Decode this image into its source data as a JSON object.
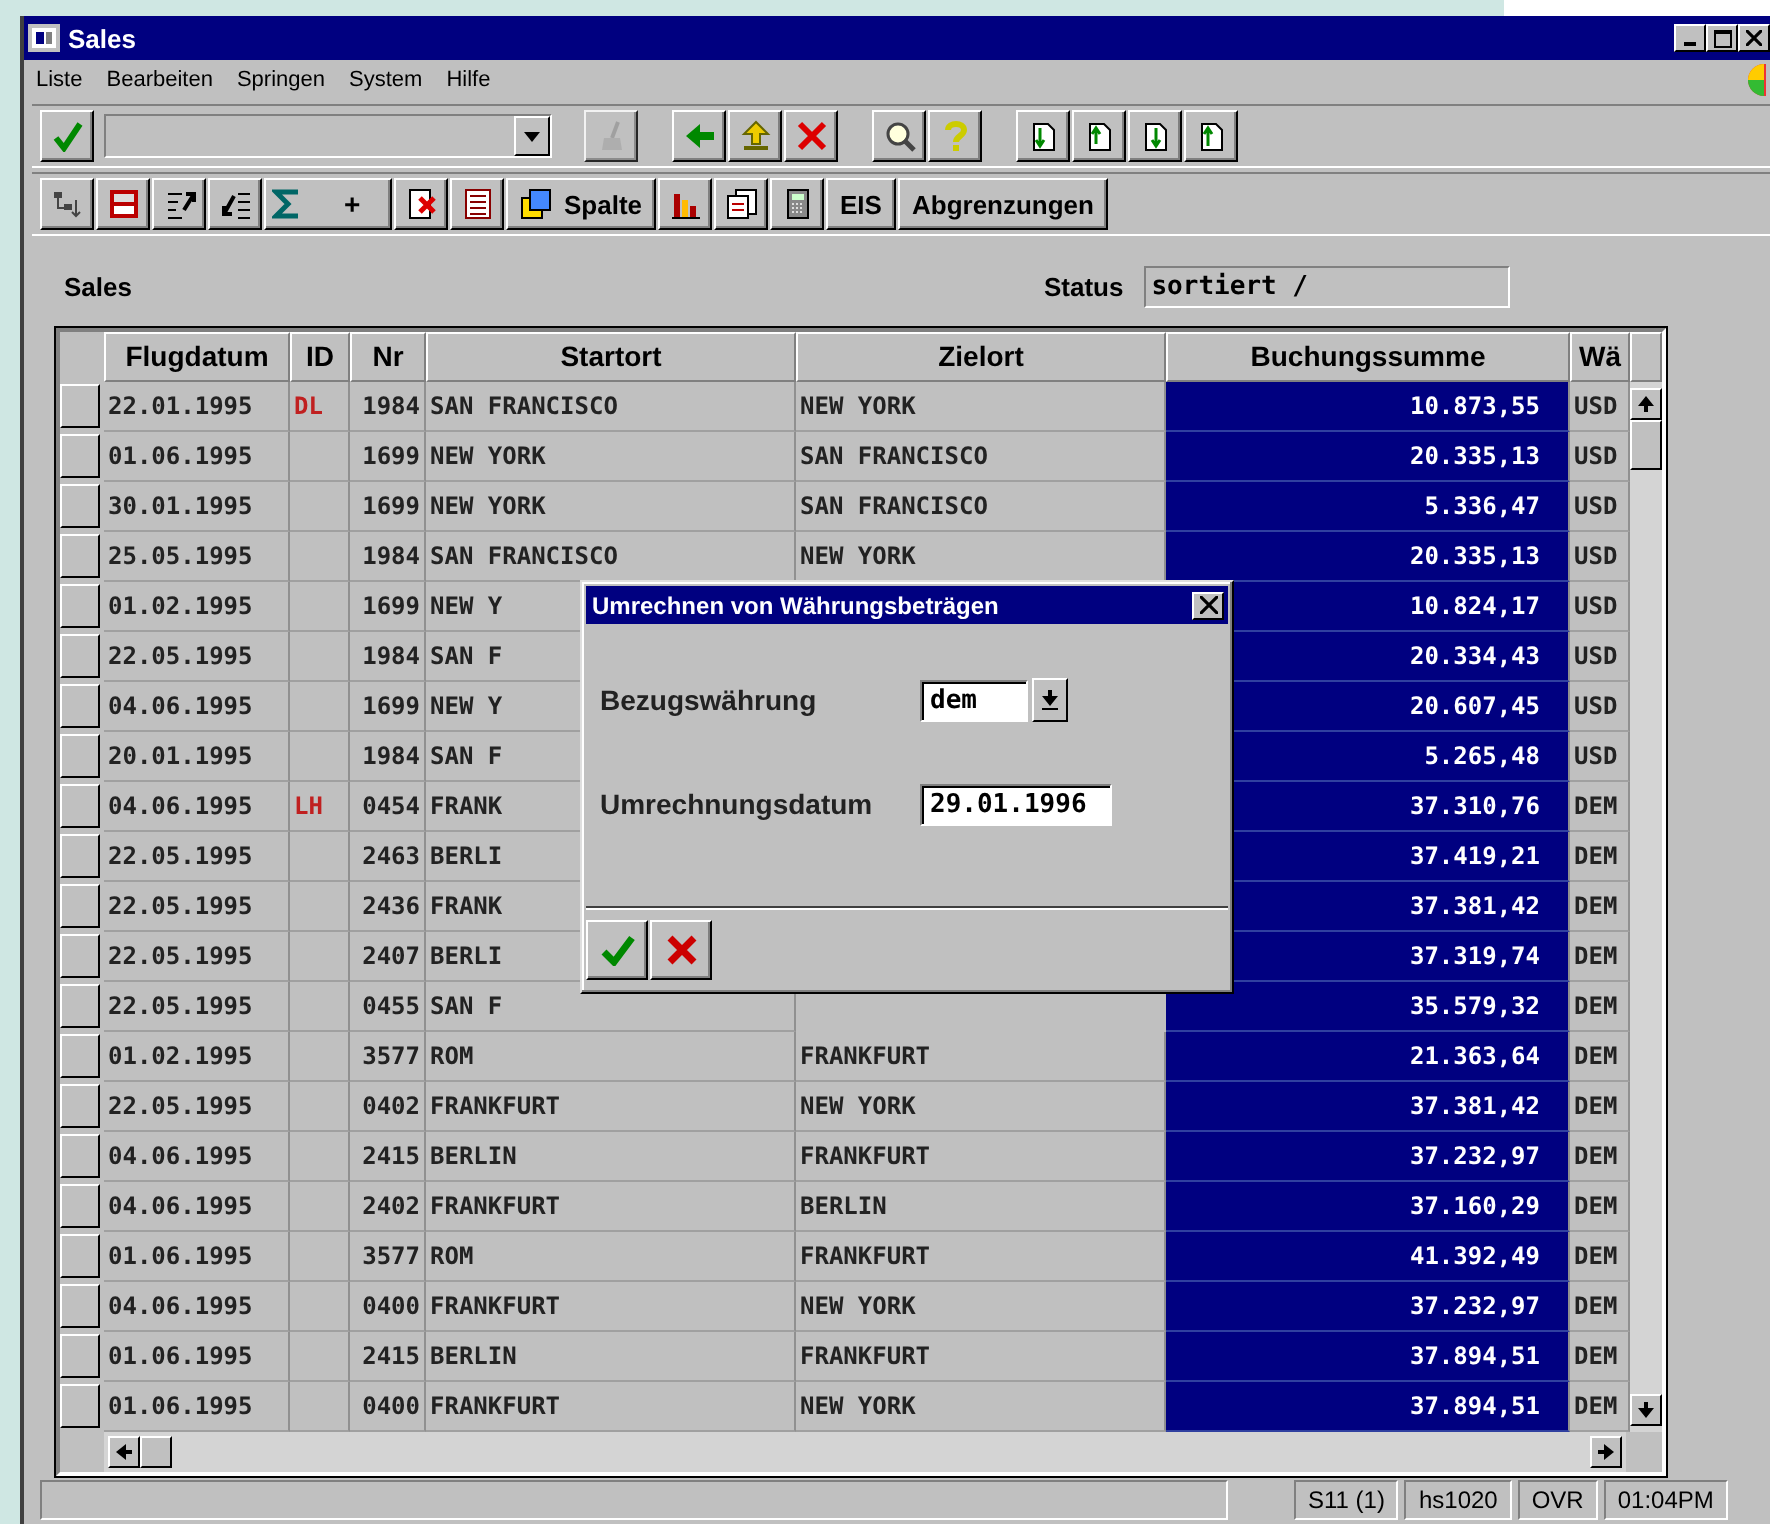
{
  "window": {
    "title": "Sales"
  },
  "menu": [
    "Liste",
    "Bearbeiten",
    "Springen",
    "System",
    "Hilfe"
  ],
  "toolbar": {
    "plus": "+",
    "column_button": "Spalte",
    "eis_button": "EIS",
    "ranges_button": "Abgrenzungen"
  },
  "header": {
    "title": "Sales",
    "status_label": "Status",
    "status_value": "sortiert /"
  },
  "table": {
    "columns": [
      {
        "label": "Flugdatum",
        "selected": false
      },
      {
        "label": "ID",
        "selected": false
      },
      {
        "label": "Nr",
        "selected": false
      },
      {
        "label": "Startort",
        "selected": false
      },
      {
        "label": "Zielort",
        "selected": false
      },
      {
        "label": "Buchungssumme",
        "selected": true
      },
      {
        "label": "Wä",
        "selected": false
      }
    ],
    "rows": [
      {
        "cells": [
          "22.01.1995",
          "DL",
          "1984",
          "SAN FRANCISCO",
          "NEW YORK",
          "10.873,55",
          "USD"
        ]
      },
      {
        "cells": [
          "01.06.1995",
          "",
          "1699",
          "NEW YORK",
          "SAN FRANCISCO",
          "20.335,13",
          "USD"
        ]
      },
      {
        "cells": [
          "30.01.1995",
          "",
          "1699",
          "NEW YORK",
          "SAN FRANCISCO",
          "5.336,47",
          "USD"
        ]
      },
      {
        "cells": [
          "25.05.1995",
          "",
          "1984",
          "SAN FRANCISCO",
          "NEW YORK",
          "20.335,13",
          "USD"
        ]
      },
      {
        "cells": [
          "01.02.1995",
          "",
          "1699",
          "NEW Y",
          "",
          "10.824,17",
          "USD"
        ]
      },
      {
        "cells": [
          "22.05.1995",
          "",
          "1984",
          "SAN F",
          "",
          "20.334,43",
          "USD"
        ]
      },
      {
        "cells": [
          "04.06.1995",
          "",
          "1699",
          "NEW Y",
          "",
          "20.607,45",
          "USD"
        ]
      },
      {
        "cells": [
          "20.01.1995",
          "",
          "1984",
          "SAN F",
          "",
          "5.265,48",
          "USD"
        ]
      },
      {
        "cells": [
          "04.06.1995",
          "LH",
          "0454",
          "FRANK",
          "",
          "37.310,76",
          "DEM"
        ]
      },
      {
        "cells": [
          "22.05.1995",
          "",
          "2463",
          "BERLI",
          "",
          "37.419,21",
          "DEM"
        ]
      },
      {
        "cells": [
          "22.05.1995",
          "",
          "2436",
          "FRANK",
          "",
          "37.381,42",
          "DEM"
        ]
      },
      {
        "cells": [
          "22.05.1995",
          "",
          "2407",
          "BERLI",
          "",
          "37.319,74",
          "DEM"
        ]
      },
      {
        "cells": [
          "22.05.1995",
          "",
          "0455",
          "SAN F",
          "",
          "35.579,32",
          "DEM"
        ]
      },
      {
        "cells": [
          "01.02.1995",
          "",
          "3577",
          "ROM",
          "FRANKFURT",
          "21.363,64",
          "DEM"
        ]
      },
      {
        "cells": [
          "22.05.1995",
          "",
          "0402",
          "FRANKFURT",
          "NEW YORK",
          "37.381,42",
          "DEM"
        ]
      },
      {
        "cells": [
          "04.06.1995",
          "",
          "2415",
          "BERLIN",
          "FRANKFURT",
          "37.232,97",
          "DEM"
        ]
      },
      {
        "cells": [
          "04.06.1995",
          "",
          "2402",
          "FRANKFURT",
          "BERLIN",
          "37.160,29",
          "DEM"
        ]
      },
      {
        "cells": [
          "01.06.1995",
          "",
          "3577",
          "ROM",
          "FRANKFURT",
          "41.392,49",
          "DEM"
        ]
      },
      {
        "cells": [
          "04.06.1995",
          "",
          "0400",
          "FRANKFURT",
          "NEW YORK",
          "37.232,97",
          "DEM"
        ]
      },
      {
        "cells": [
          "01.06.1995",
          "",
          "2415",
          "BERLIN",
          "FRANKFURT",
          "37.894,51",
          "DEM"
        ]
      },
      {
        "cells": [
          "01.06.1995",
          "",
          "0400",
          "FRANKFURT",
          "NEW YORK",
          "37.894,51",
          "DEM"
        ]
      }
    ]
  },
  "dialog": {
    "title": "Umrechnen von Währungsbeträgen",
    "currency_label": "Bezugswährung",
    "currency_value": "dem",
    "date_label": "Umrechnungsdatum",
    "date_value": "29.01.1996"
  },
  "status_bar": [
    "S11 (1)",
    "hs1020",
    "OVR",
    "01:04PM"
  ]
}
